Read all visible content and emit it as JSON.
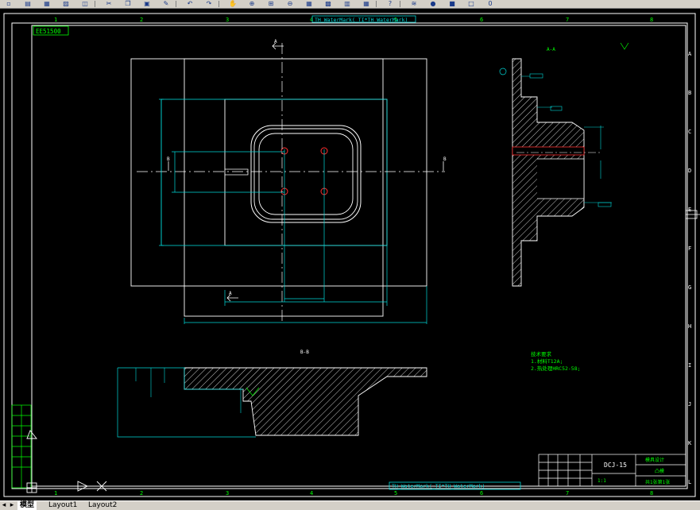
{
  "toolbar": {
    "buttons": [
      {
        "name": "new-icon",
        "glyph": "▫"
      },
      {
        "name": "open-icon",
        "glyph": "▤"
      },
      {
        "name": "save-icon",
        "glyph": "▦"
      },
      {
        "name": "print-icon",
        "glyph": "▨"
      },
      {
        "name": "preview-icon",
        "glyph": "◫"
      },
      {
        "name": "cut-icon",
        "glyph": "✂"
      },
      {
        "name": "copy-icon",
        "glyph": "❐"
      },
      {
        "name": "paste-icon",
        "glyph": "▣"
      },
      {
        "name": "matchprop-icon",
        "glyph": "✎"
      },
      {
        "name": "undo-icon",
        "glyph": "↶"
      },
      {
        "name": "redo-icon",
        "glyph": "↷"
      },
      {
        "name": "pan-icon",
        "glyph": "✋"
      },
      {
        "name": "zoom-realtime-icon",
        "glyph": "⊕"
      },
      {
        "name": "zoom-window-icon",
        "glyph": "⊞"
      },
      {
        "name": "zoom-previous-icon",
        "glyph": "⊖"
      },
      {
        "name": "properties-icon",
        "glyph": "▦"
      },
      {
        "name": "designcenter-icon",
        "glyph": "▩"
      },
      {
        "name": "toolpalette-icon",
        "glyph": "▥"
      },
      {
        "name": "calculator-icon",
        "glyph": "▦"
      },
      {
        "name": "help-icon",
        "glyph": "?"
      },
      {
        "name": "layer-icon",
        "glyph": "≋"
      },
      {
        "name": "layer-state-icon",
        "glyph": "●"
      },
      {
        "name": "layer-color-icon",
        "glyph": "■"
      },
      {
        "name": "layer-lock-icon",
        "glyph": "□"
      },
      {
        "name": "layer-name-icon",
        "glyph": "0"
      }
    ]
  },
  "drawing": {
    "watermark_top": "TH_WaterMark(_TI*TH_WaterMark)",
    "watermark_bottom": "TH_WaterMark(_TI*TH_WaterMark)",
    "doc_code": "EE51500",
    "section_aa_label": "A-A",
    "section_bb_label": "B-B",
    "section_marks": {
      "a": "A",
      "b": "B"
    },
    "col_labels": [
      "1",
      "2",
      "3",
      "4",
      "5",
      "6",
      "7",
      "8"
    ],
    "row_labels": [
      "A",
      "B",
      "C",
      "D",
      "E",
      "F",
      "G",
      "H",
      "I",
      "J",
      "K",
      "L"
    ],
    "notes": {
      "title": "技术要求",
      "line1": "1.材料T12A;",
      "line2": "2.热处理HRC52-58;"
    },
    "title_block": {
      "part_no": "DCJ-15",
      "part_name": "凸模",
      "company": "模具设计",
      "scale": "1:1",
      "sheet": "共1张第1张"
    }
  },
  "tabs": [
    {
      "label": "模型",
      "active": true
    },
    {
      "label": "Layout1",
      "active": false
    },
    {
      "label": "Layout2",
      "active": false
    }
  ],
  "colors": {
    "background": "#000000",
    "line_white": "#ffffff",
    "line_cyan": "#00d8d8",
    "line_green": "#00ff00",
    "line_red": "#ff3030"
  }
}
